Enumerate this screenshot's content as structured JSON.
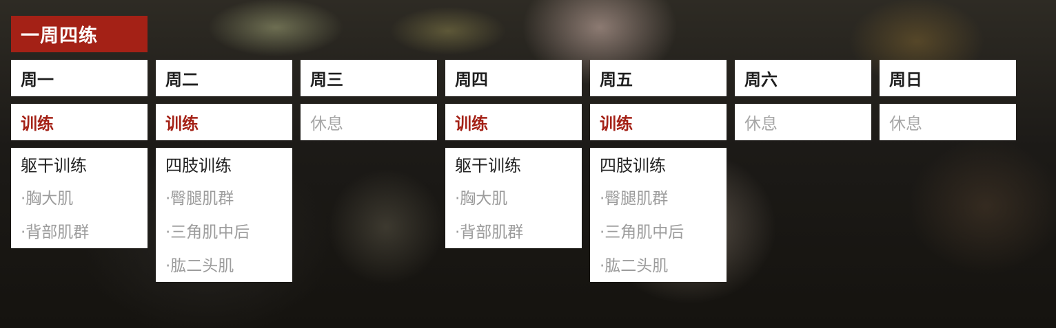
{
  "title": "一周四练",
  "accent_color": "#a42116",
  "days": [
    {
      "day": "周一",
      "status": "训练",
      "is_training": true,
      "detail_title": "躯干训练",
      "items": [
        "·胸大肌",
        "·背部肌群"
      ]
    },
    {
      "day": "周二",
      "status": "训练",
      "is_training": true,
      "detail_title": "四肢训练",
      "items": [
        "·臀腿肌群",
        "·三角肌中后",
        "·肱二头肌"
      ]
    },
    {
      "day": "周三",
      "status": "休息",
      "is_training": false
    },
    {
      "day": "周四",
      "status": "训练",
      "is_training": true,
      "detail_title": "躯干训练",
      "items": [
        "·胸大肌",
        "·背部肌群"
      ]
    },
    {
      "day": "周五",
      "status": "训练",
      "is_training": true,
      "detail_title": "四肢训练",
      "items": [
        "·臀腿肌群",
        "·三角肌中后",
        "·肱二头肌"
      ]
    },
    {
      "day": "周六",
      "status": "休息",
      "is_training": false
    },
    {
      "day": "周日",
      "status": "休息",
      "is_training": false
    }
  ]
}
